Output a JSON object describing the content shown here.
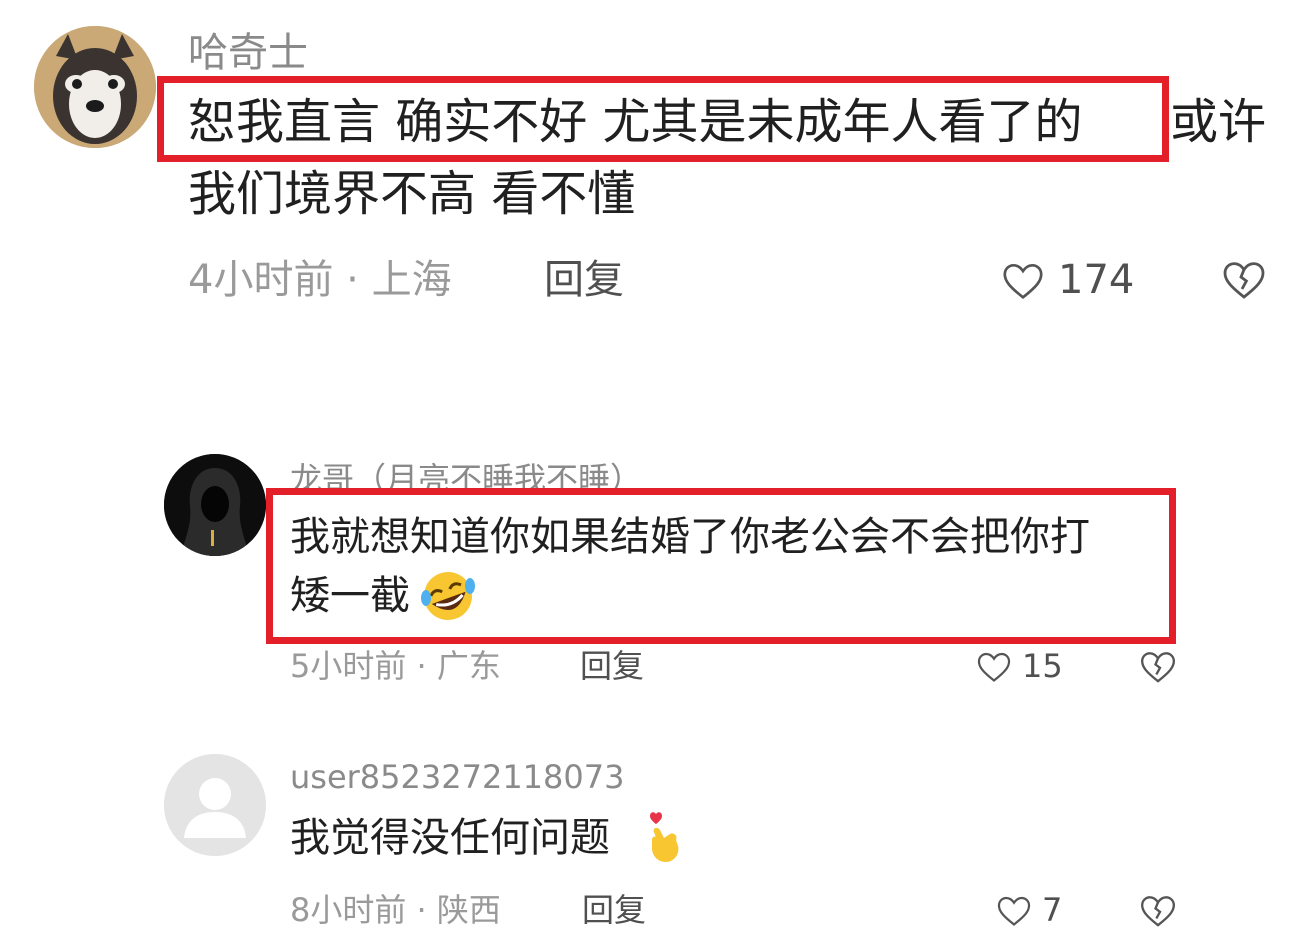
{
  "comments": [
    {
      "username": "哈奇士",
      "avatar_icon": "husky-avatar",
      "text_line1_highlight": "恕我直言 确实不好 尤其是未成年人看了的",
      "text_line1_rest": "或许",
      "text_line2": "我们境界不高 看不懂",
      "time_location": "4小时前 · 上海",
      "reply_label": "回复",
      "likes": "174"
    },
    {
      "username": "龙哥（月亮不睡我不睡）",
      "avatar_icon": "hooded-figure-avatar",
      "text_line1": "我就想知道你如果结婚了你老公会不会把你打",
      "text_line2": "矮一截",
      "emoji": "rolling-laughing-emoji",
      "time_location": "5小时前 · 广东",
      "reply_label": "回复",
      "likes": "15"
    },
    {
      "username": "user8523272118073",
      "avatar_icon": "default-user-avatar",
      "text_line1": "我觉得没任何问题",
      "emoji": "finger-heart-emoji",
      "time_location": "8小时前 · 陕西",
      "reply_label": "回复",
      "likes": "7"
    }
  ],
  "highlight_color": "#e3202a"
}
